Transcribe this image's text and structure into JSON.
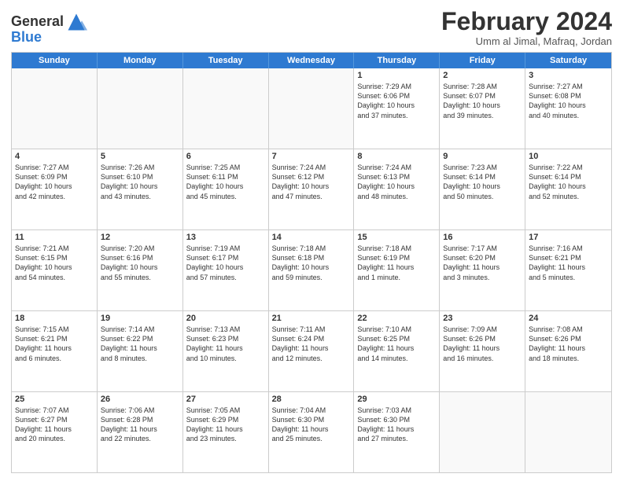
{
  "header": {
    "logo_line1": "General",
    "logo_line2": "Blue",
    "month_title": "February 2024",
    "location": "Umm al Jimal, Mafraq, Jordan"
  },
  "weekdays": [
    "Sunday",
    "Monday",
    "Tuesday",
    "Wednesday",
    "Thursday",
    "Friday",
    "Saturday"
  ],
  "weeks": [
    [
      {
        "day": "",
        "info": ""
      },
      {
        "day": "",
        "info": ""
      },
      {
        "day": "",
        "info": ""
      },
      {
        "day": "",
        "info": ""
      },
      {
        "day": "1",
        "info": "Sunrise: 7:29 AM\nSunset: 6:06 PM\nDaylight: 10 hours\nand 37 minutes."
      },
      {
        "day": "2",
        "info": "Sunrise: 7:28 AM\nSunset: 6:07 PM\nDaylight: 10 hours\nand 39 minutes."
      },
      {
        "day": "3",
        "info": "Sunrise: 7:27 AM\nSunset: 6:08 PM\nDaylight: 10 hours\nand 40 minutes."
      }
    ],
    [
      {
        "day": "4",
        "info": "Sunrise: 7:27 AM\nSunset: 6:09 PM\nDaylight: 10 hours\nand 42 minutes."
      },
      {
        "day": "5",
        "info": "Sunrise: 7:26 AM\nSunset: 6:10 PM\nDaylight: 10 hours\nand 43 minutes."
      },
      {
        "day": "6",
        "info": "Sunrise: 7:25 AM\nSunset: 6:11 PM\nDaylight: 10 hours\nand 45 minutes."
      },
      {
        "day": "7",
        "info": "Sunrise: 7:24 AM\nSunset: 6:12 PM\nDaylight: 10 hours\nand 47 minutes."
      },
      {
        "day": "8",
        "info": "Sunrise: 7:24 AM\nSunset: 6:13 PM\nDaylight: 10 hours\nand 48 minutes."
      },
      {
        "day": "9",
        "info": "Sunrise: 7:23 AM\nSunset: 6:14 PM\nDaylight: 10 hours\nand 50 minutes."
      },
      {
        "day": "10",
        "info": "Sunrise: 7:22 AM\nSunset: 6:14 PM\nDaylight: 10 hours\nand 52 minutes."
      }
    ],
    [
      {
        "day": "11",
        "info": "Sunrise: 7:21 AM\nSunset: 6:15 PM\nDaylight: 10 hours\nand 54 minutes."
      },
      {
        "day": "12",
        "info": "Sunrise: 7:20 AM\nSunset: 6:16 PM\nDaylight: 10 hours\nand 55 minutes."
      },
      {
        "day": "13",
        "info": "Sunrise: 7:19 AM\nSunset: 6:17 PM\nDaylight: 10 hours\nand 57 minutes."
      },
      {
        "day": "14",
        "info": "Sunrise: 7:18 AM\nSunset: 6:18 PM\nDaylight: 10 hours\nand 59 minutes."
      },
      {
        "day": "15",
        "info": "Sunrise: 7:18 AM\nSunset: 6:19 PM\nDaylight: 11 hours\nand 1 minute."
      },
      {
        "day": "16",
        "info": "Sunrise: 7:17 AM\nSunset: 6:20 PM\nDaylight: 11 hours\nand 3 minutes."
      },
      {
        "day": "17",
        "info": "Sunrise: 7:16 AM\nSunset: 6:21 PM\nDaylight: 11 hours\nand 5 minutes."
      }
    ],
    [
      {
        "day": "18",
        "info": "Sunrise: 7:15 AM\nSunset: 6:21 PM\nDaylight: 11 hours\nand 6 minutes."
      },
      {
        "day": "19",
        "info": "Sunrise: 7:14 AM\nSunset: 6:22 PM\nDaylight: 11 hours\nand 8 minutes."
      },
      {
        "day": "20",
        "info": "Sunrise: 7:13 AM\nSunset: 6:23 PM\nDaylight: 11 hours\nand 10 minutes."
      },
      {
        "day": "21",
        "info": "Sunrise: 7:11 AM\nSunset: 6:24 PM\nDaylight: 11 hours\nand 12 minutes."
      },
      {
        "day": "22",
        "info": "Sunrise: 7:10 AM\nSunset: 6:25 PM\nDaylight: 11 hours\nand 14 minutes."
      },
      {
        "day": "23",
        "info": "Sunrise: 7:09 AM\nSunset: 6:26 PM\nDaylight: 11 hours\nand 16 minutes."
      },
      {
        "day": "24",
        "info": "Sunrise: 7:08 AM\nSunset: 6:26 PM\nDaylight: 11 hours\nand 18 minutes."
      }
    ],
    [
      {
        "day": "25",
        "info": "Sunrise: 7:07 AM\nSunset: 6:27 PM\nDaylight: 11 hours\nand 20 minutes."
      },
      {
        "day": "26",
        "info": "Sunrise: 7:06 AM\nSunset: 6:28 PM\nDaylight: 11 hours\nand 22 minutes."
      },
      {
        "day": "27",
        "info": "Sunrise: 7:05 AM\nSunset: 6:29 PM\nDaylight: 11 hours\nand 23 minutes."
      },
      {
        "day": "28",
        "info": "Sunrise: 7:04 AM\nSunset: 6:30 PM\nDaylight: 11 hours\nand 25 minutes."
      },
      {
        "day": "29",
        "info": "Sunrise: 7:03 AM\nSunset: 6:30 PM\nDaylight: 11 hours\nand 27 minutes."
      },
      {
        "day": "",
        "info": ""
      },
      {
        "day": "",
        "info": ""
      }
    ]
  ]
}
